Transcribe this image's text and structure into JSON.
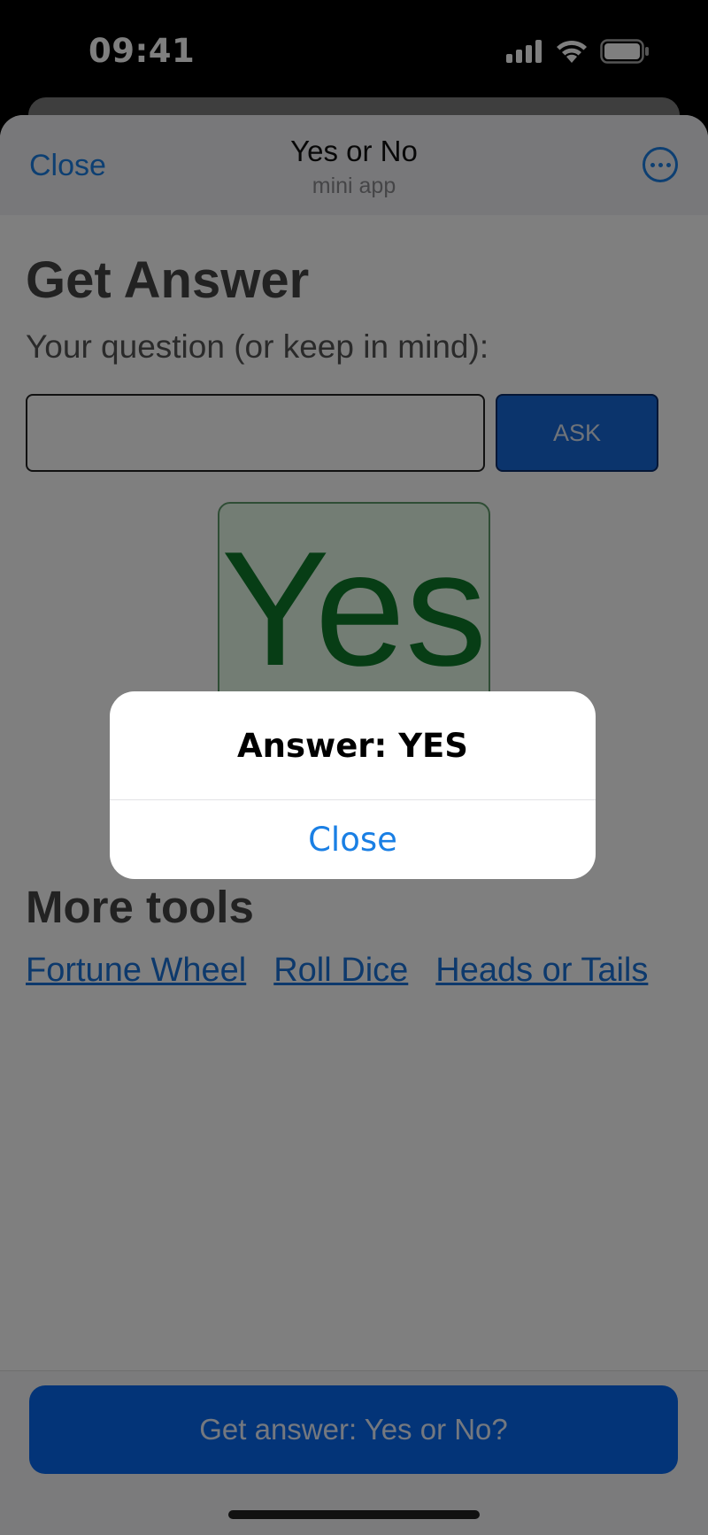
{
  "status_bar": {
    "time": "09:41",
    "icons": [
      "signal-icon",
      "wifi-icon",
      "battery-icon"
    ]
  },
  "header": {
    "close_label": "Close",
    "title": "Yes or No",
    "subtitle": "mini app",
    "more_icon": "ellipsis-circle-icon"
  },
  "main": {
    "title": "Get Answer",
    "question_label": "Your question (or keep in mind):",
    "question_value": "",
    "ask_label": "ASK",
    "answer": "Yes",
    "more_tools_title": "More tools",
    "tools": [
      "Fortune Wheel",
      "Roll Dice",
      "Heads or Tails"
    ]
  },
  "bottom_button_label": "Get answer: Yes or No?",
  "alert": {
    "title": "Answer: YES",
    "close_label": "Close"
  },
  "colors": {
    "accent": "#1a7fe4",
    "primary_button": "#0768f0",
    "answer_green": "#0f7a2a",
    "answer_bg": "#e6fbe8"
  }
}
